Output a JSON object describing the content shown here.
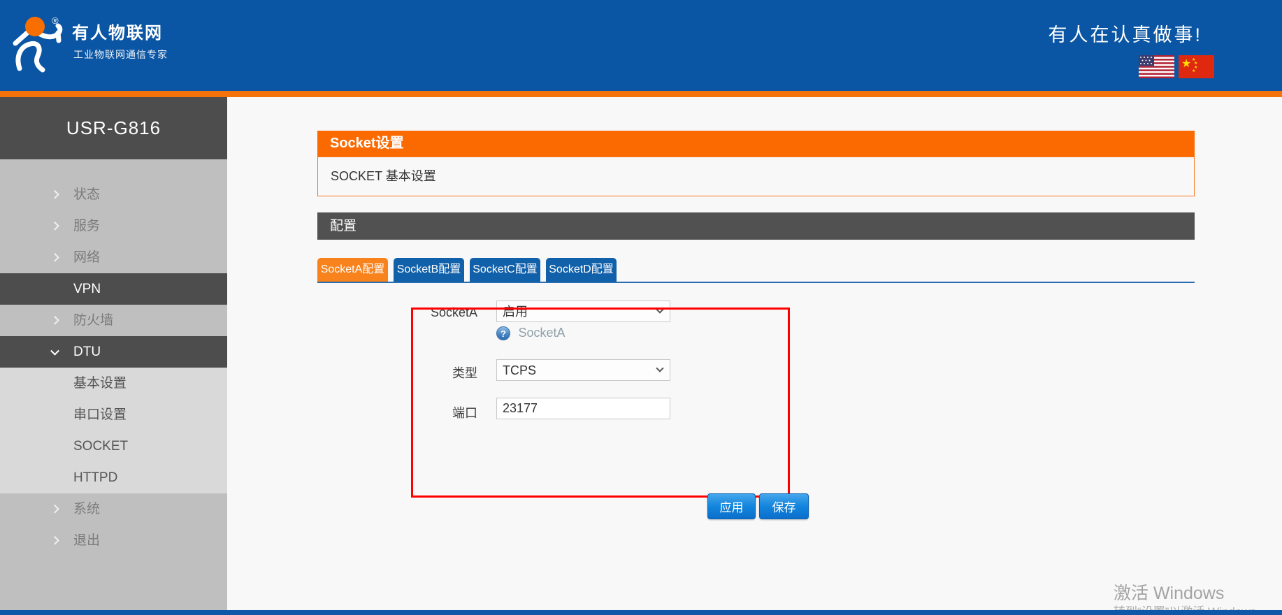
{
  "header": {
    "logo_title": "有人物联网",
    "logo_subtitle": "工业物联网通信专家",
    "logo_reg": "®",
    "slogan": "有人在认真做事!"
  },
  "sidebar": {
    "device_name": "USR-G816",
    "items": [
      {
        "label": "状态"
      },
      {
        "label": "服务"
      },
      {
        "label": "网络"
      },
      {
        "label": "VPN"
      },
      {
        "label": "防火墙"
      },
      {
        "label": "DTU"
      },
      {
        "label": "基本设置"
      },
      {
        "label": "串口设置"
      },
      {
        "label": "SOCKET"
      },
      {
        "label": "HTTPD"
      },
      {
        "label": "系统"
      },
      {
        "label": "退出"
      }
    ]
  },
  "main": {
    "page_title": "Socket设置",
    "page_subtitle": "SOCKET 基本设置",
    "section_title": "配置",
    "tabs": [
      {
        "label": "SocketA配置",
        "active": true
      },
      {
        "label": "SocketB配置",
        "active": false
      },
      {
        "label": "SocketC配置",
        "active": false
      },
      {
        "label": "SocketD配置",
        "active": false
      }
    ],
    "form": {
      "socketa_label": "SocketA",
      "socketa_value": "启用",
      "help_icon_glyph": "?",
      "socketa_help": "SocketA",
      "type_label": "类型",
      "type_value": "TCPS",
      "port_label": "端口",
      "port_value": "23177"
    },
    "buttons": {
      "apply": "应用",
      "save": "保存"
    }
  },
  "watermark": {
    "line1": "激活 Windows",
    "line2": "转到“设置”以激活 Windows"
  },
  "colors": {
    "brand_blue": "#0a56a4",
    "accent_orange": "#fb6a00",
    "stripe_orange": "#f4720b",
    "tab_blue": "#1160aa",
    "active_tab_orange": "#f8821c",
    "sidebar_dark": "#4d4d4d",
    "sidebar_gray": "#bfbfbf",
    "highlight_red": "#fe0000",
    "button_blue": "#1385dd"
  }
}
